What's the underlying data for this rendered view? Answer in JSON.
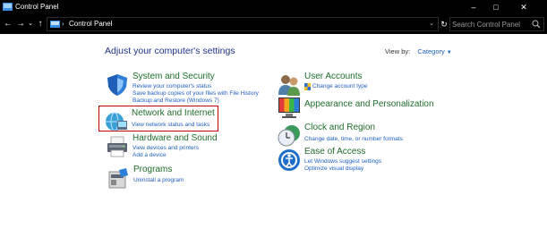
{
  "window": {
    "title": "Control Panel"
  },
  "nav": {
    "back": "←",
    "forward": "→",
    "recent": "⌄",
    "up": "↑",
    "separator": "›",
    "breadcrumb": "Control Panel",
    "dropdown": "⌄",
    "refresh": "↻"
  },
  "search": {
    "placeholder": "Search Control Panel"
  },
  "main": {
    "title": "Adjust your computer's settings",
    "view_by_label": "View by:",
    "view_by_value": "Category"
  },
  "categories_left": [
    {
      "name": "System and Security",
      "icon": "shield-icon",
      "links": [
        "Review your computer's status",
        "Save backup copies of your files with File History",
        "Backup and Restore (Windows 7)"
      ]
    },
    {
      "name": "Network and Internet",
      "icon": "network-globe-icon",
      "links": [
        "View network status and tasks"
      ]
    },
    {
      "name": "Hardware and Sound",
      "icon": "printer-icon",
      "links": [
        "View devices and printers",
        "Add a device"
      ]
    },
    {
      "name": "Programs",
      "icon": "programs-icon",
      "links": [
        "Uninstall a program"
      ]
    }
  ],
  "categories_right": [
    {
      "name": "User Accounts",
      "icon": "users-icon",
      "links": [
        "Change account type"
      ]
    },
    {
      "name": "Appearance and Personalization",
      "icon": "display-colors-icon",
      "links": []
    },
    {
      "name": "Clock and Region",
      "icon": "clock-globe-icon",
      "links": [
        "Change date, time, or number formats"
      ]
    },
    {
      "name": "Ease of Access",
      "icon": "ease-of-access-icon",
      "links": [
        "Let Windows suggest settings",
        "Optimize visual display"
      ]
    }
  ],
  "colors": {
    "heading": "#1e6e2a",
    "link": "#1e5fbf",
    "title": "#1e3287",
    "highlight": "#c00000"
  }
}
